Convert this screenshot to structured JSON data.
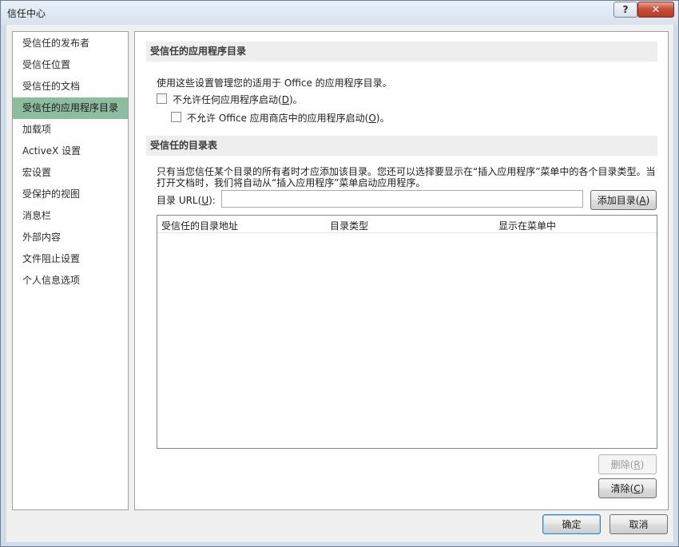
{
  "window": {
    "title": "信任中心",
    "help_label": "?",
    "close_label": "✕"
  },
  "sidebar": {
    "items": [
      {
        "label": "受信任的发布者"
      },
      {
        "label": "受信任位置"
      },
      {
        "label": "受信任的文档"
      },
      {
        "label": "受信任的应用程序目录"
      },
      {
        "label": "加载项"
      },
      {
        "label": "ActiveX 设置"
      },
      {
        "label": "宏设置"
      },
      {
        "label": "受保护的视图"
      },
      {
        "label": "消息栏"
      },
      {
        "label": "外部内容"
      },
      {
        "label": "文件阻止设置"
      },
      {
        "label": "个人信息选项"
      }
    ],
    "active_index": 3
  },
  "catalog_section": {
    "header": "受信任的应用程序目录",
    "description": "使用这些设置管理您的适用于 Office 的应用程序目录。",
    "option1_pre": "不允许任何应用程序启动(",
    "option1_key": "D",
    "option1_post": ")。",
    "option2_pre": "不允许 Office 应用商店中的应用程序启动(",
    "option2_key": "O",
    "option2_post": ")。"
  },
  "table_section": {
    "header": "受信任的目录表",
    "desc_line1": "只有当您信任某个目录的所有者时才应添加该目录。您还可以选择要显示在“插入应用程序”菜单中的各个目录类型。当",
    "desc_line2": "打开文档时，我们将自动从“插入应用程序”菜单启动应用程序。",
    "url_label_pre": "目录 URL(",
    "url_label_key": "U",
    "url_label_post": "):",
    "url_value": "",
    "add_pre": "添加目录(",
    "add_key": "A",
    "add_post": ")",
    "columns": [
      "受信任的目录地址",
      "目录类型",
      "显示在菜单中"
    ],
    "remove_pre": "删除(",
    "remove_key": "R",
    "remove_post": ")",
    "clear_pre": "清除(",
    "clear_key": "C",
    "clear_post": ")"
  },
  "footer": {
    "ok_label": "确定",
    "cancel_label": "取消"
  }
}
